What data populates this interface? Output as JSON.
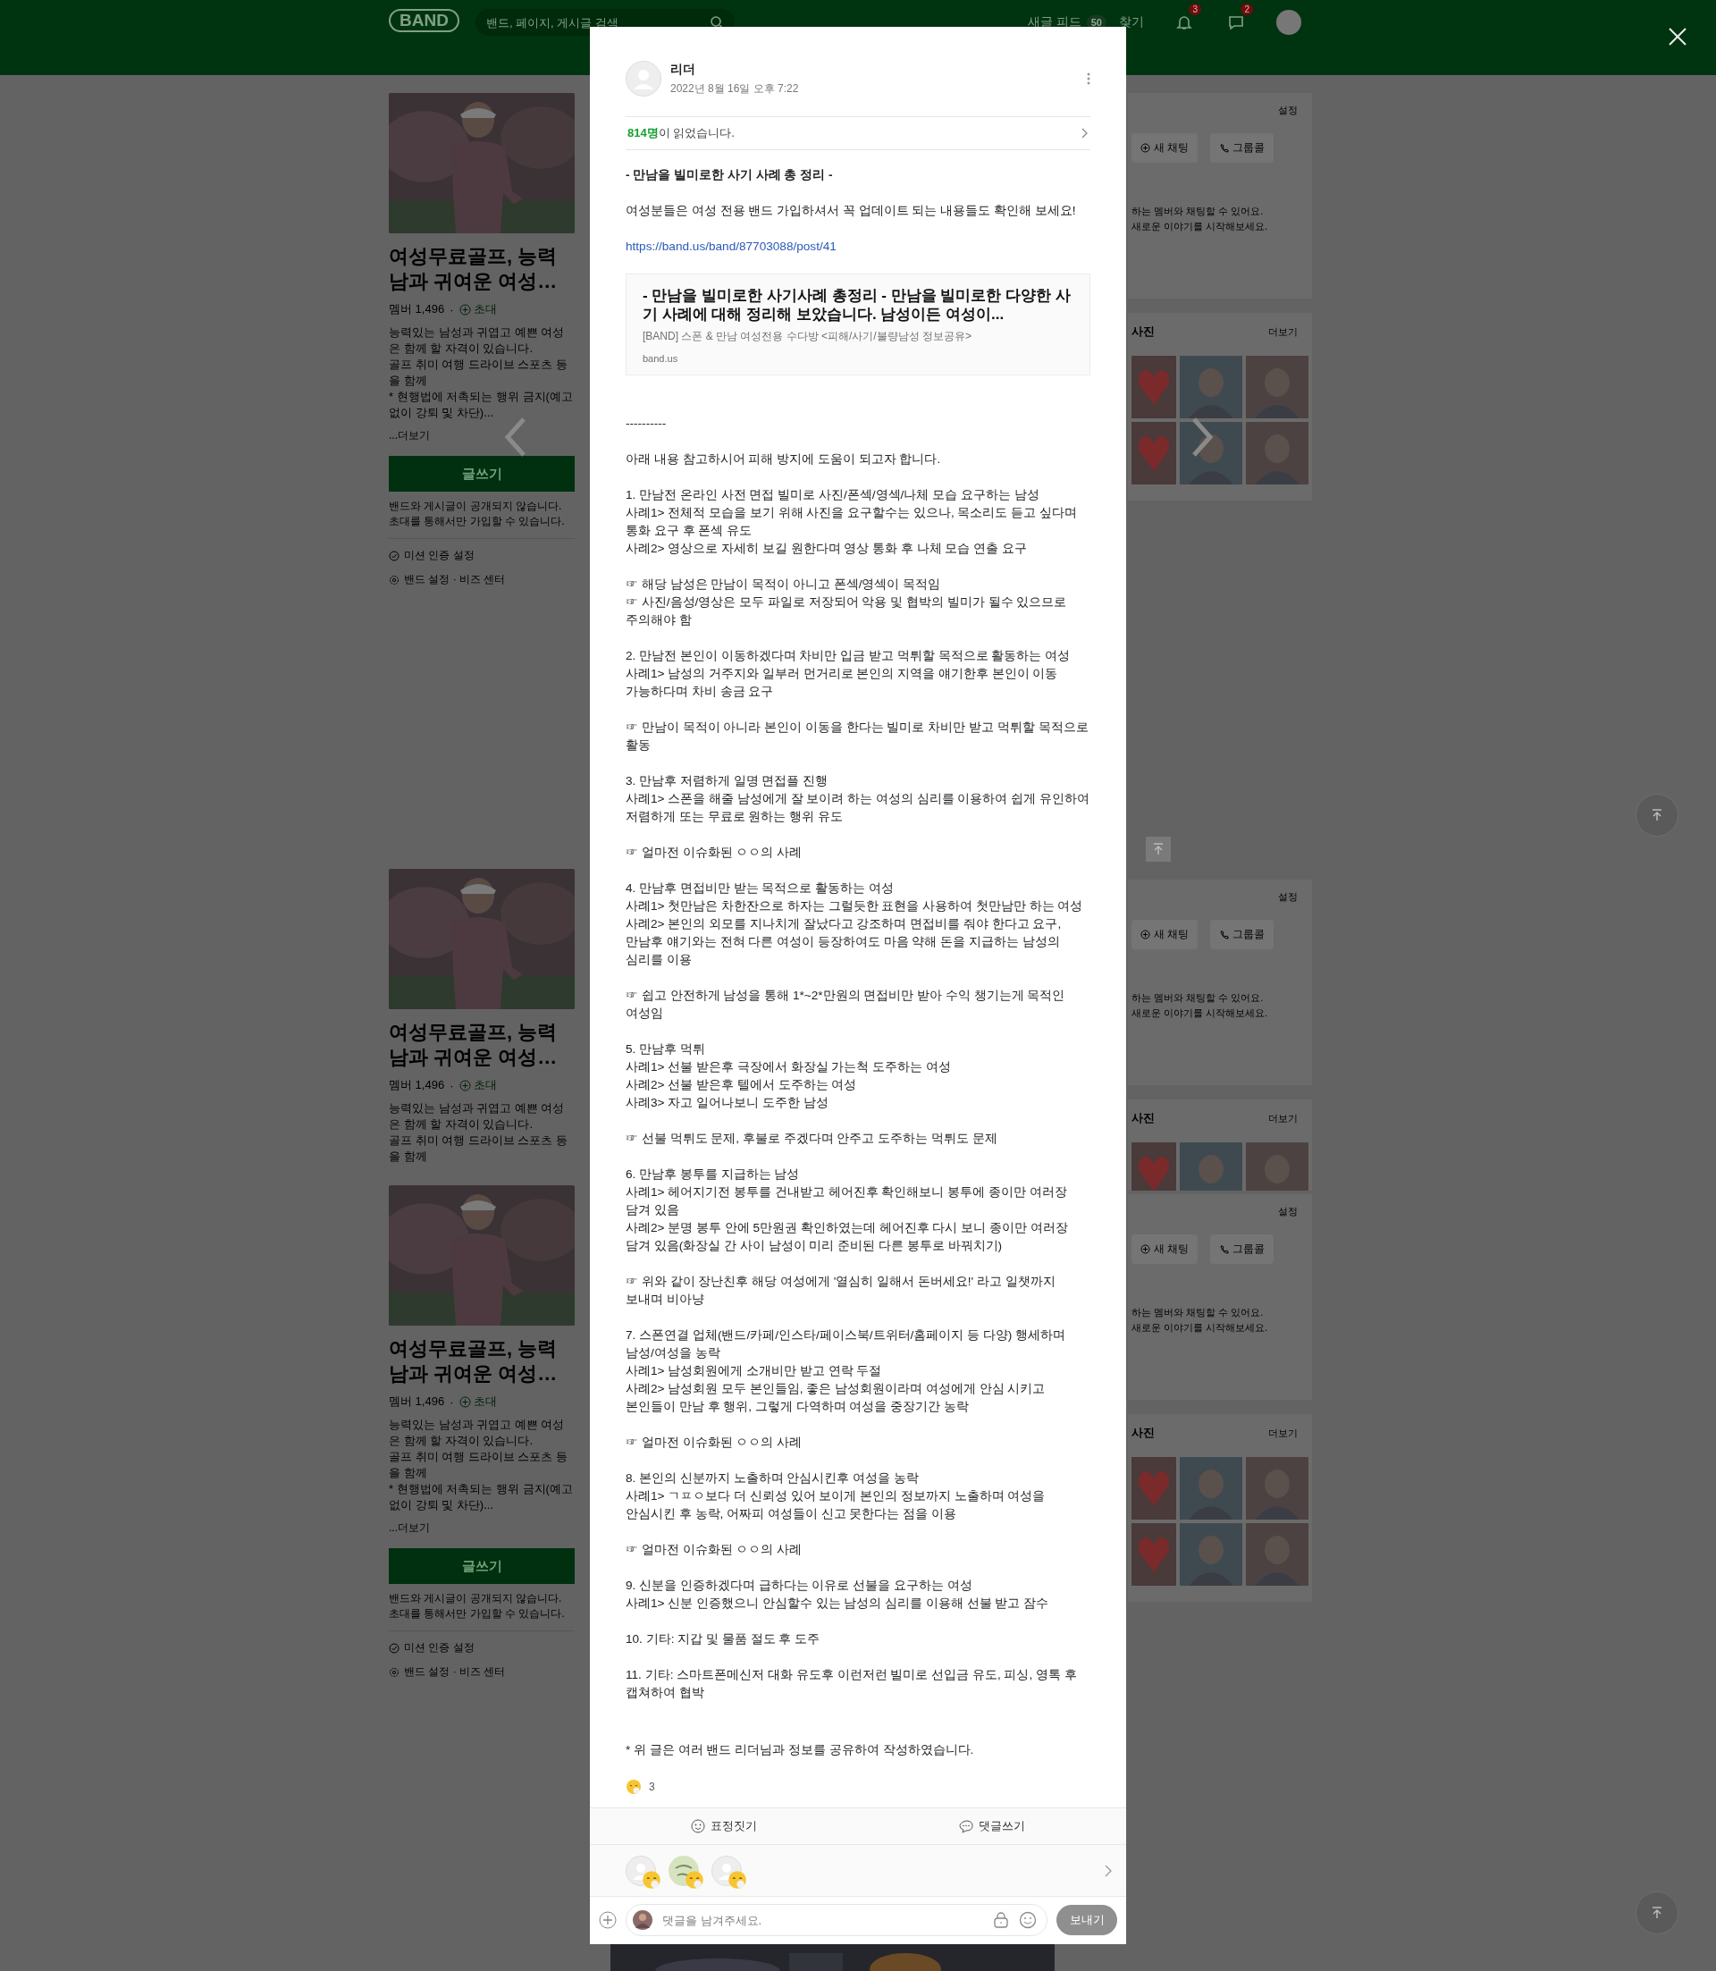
{
  "header": {
    "logo": "BAND",
    "search": {
      "placeholder": "밴드, 페이지, 게시글 검색"
    },
    "feed": {
      "label": "새글 피드",
      "count": "50"
    },
    "find": "찾기",
    "notifications": [
      {
        "kind": "bell",
        "badge": "3"
      },
      {
        "kind": "chat",
        "badge": "2"
      }
    ]
  },
  "left_cards": [
    {
      "kind": "full",
      "title": "여성무료골프, 능력남과 귀여운 여성…",
      "members": "멤버 1,496",
      "separator": "·",
      "invite": "초대",
      "description": "능력있는 남성과 귀엽고 예쁜 여성은 함께 할 자격이 있습니다.\n골프 취미 여행 드라이브 스포츠 등을 함께\n* 현행법에 저촉되는 행위 금지(예고없이 강퇴 및 차단)...",
      "more": "...더보기",
      "write_button": "글쓰기",
      "notice": "밴드와 게시글이 공개되지 않습니다.\n초대를 통해서만 가입할 수 있습니다.",
      "links": [
        {
          "kind": "mission",
          "label": "미션 인증 설정"
        },
        {
          "kind": "settings",
          "label": "밴드 설정 · 비즈 센터"
        }
      ]
    },
    {
      "kind": "cut",
      "title": "여성무료골프, 능력남과 귀여운 여성…",
      "members": "멤버 1,496",
      "separator": "·",
      "invite": "초대",
      "description": "능력있는 남성과 귀엽고 예쁜 여성은 함께 할 자격이 있습니다.\n골프 취미 여행 드라이브 스포츠 등을 함께"
    },
    {
      "kind": "full",
      "title": "여성무료골프, 능력남과 귀여운 여성…",
      "members": "멤버 1,496",
      "separator": "·",
      "invite": "초대",
      "description": "능력있는 남성과 귀엽고 예쁜 여성은 함께 할 자격이 있습니다.\n골프 취미 여행 드라이브 스포츠 등을 함께\n* 현행법에 저촉되는 행위 금지(예고없이 강퇴 및 차단)...",
      "more": "...더보기",
      "write_button": "글쓰기",
      "notice": "밴드와 게시글이 공개되지 않습니다.\n초대를 통해서만 가입할 수 있습니다.",
      "links": [
        {
          "kind": "mission",
          "label": "미션 인증 설정"
        },
        {
          "kind": "settings",
          "label": "밴드 설정 · 비즈 센터"
        }
      ]
    }
  ],
  "right_panels": [
    {
      "kind": "chat",
      "settings": "설정",
      "buttons": [
        {
          "kind": "chat",
          "label": "새 채팅"
        },
        {
          "kind": "call",
          "label": "그룹콜"
        }
      ],
      "text": "하는 멤버와 채팅할 수 있어요.\n새로운 이야기를 시작해보세요."
    },
    {
      "kind": "photos",
      "title": "사진",
      "more": "더보기"
    },
    {
      "kind": "top"
    },
    {
      "kind": "chat",
      "settings": "설정",
      "buttons": [
        {
          "kind": "chat",
          "label": "새 채팅"
        },
        {
          "kind": "call",
          "label": "그룹콜"
        }
      ],
      "text": "하는 멤버와 채팅할 수 있어요.\n새로운 이야기를 시작해보세요."
    },
    {
      "kind": "photos_short",
      "title": "사진",
      "more": "더보기"
    },
    {
      "kind": "chat",
      "settings": "설정",
      "buttons": [
        {
          "kind": "chat",
          "label": "새 채팅"
        },
        {
          "kind": "call",
          "label": "그룹콜"
        }
      ],
      "text": "하는 멤버와 채팅할 수 있어요.\n새로운 이야기를 시작해보세요."
    },
    {
      "kind": "photos",
      "title": "사진",
      "more": "더보기"
    }
  ],
  "post": {
    "author": "리더",
    "date": "2022년 8월 16일 오후 7:22",
    "readers": "**814명**이 읽었습니다.",
    "body": [
      {
        "kind": "heading",
        "lines": [
          "- 만남을 빌미로한 사기 사례 총 정리 -"
        ]
      },
      {
        "kind": "text",
        "lines": [
          "여성분들은 여성 전용 밴드 가입하셔서 꼭 업데이트 되는 내용들도 확인해 보세요!"
        ]
      },
      {
        "kind": "link",
        "lines": [
          "https://band.us/band/87703088/post/41"
        ]
      },
      {
        "kind": "preview",
        "title": "- 만남을 빌미로한 사기사례 총정리 - 만남을 빌미로한 다양한 사기 사례에 대해 정리해 보았습니다. 남성이든 여성이...",
        "source": "[BAND] 스폰 & 만남 여성전용 수다방 <피해/사기/불량남성 정보공유>",
        "domain": "band.us"
      },
      {
        "kind": "spacer"
      },
      {
        "kind": "text",
        "lines": [
          "----------"
        ]
      },
      {
        "kind": "text",
        "lines": [
          "아래 내용 참고하시어 피해 방지에 도움이 되고자 합니다."
        ]
      },
      {
        "kind": "text",
        "lines": [
          "1. 만남전 온라인 사전 면접 빌미로 사진/폰섹/영섹/나체 모습 요구하는 남성",
          "사례1> 전체적 모습을 보기 위해 사진을 요구할수는 있으나, 목소리도 듣고 싶다며 통화 요구 후 폰섹 유도",
          "사례2> 영상으로 자세히 보길 원한다며 영상 통화 후 나체 모습 연출 요구"
        ]
      },
      {
        "kind": "text",
        "lines": [
          "☞ 해당 남성은 만남이 목적이 아니고 폰섹/영섹이 목적임",
          "☞ 사진/음성/영상은 모두 파일로 저장되어 악용 및 협박의 빌미가 될수 있으므로 주의해야 함"
        ]
      },
      {
        "kind": "text",
        "lines": [
          "2. 만남전 본인이 이동하겠다며 차비만 입금 받고 먹튀할 목적으로 활동하는 여성",
          "사례1> 남성의 거주지와 일부러 먼거리로 본인의 지역을 얘기한후 본인이 이동 가능하다며 차비 송금 요구"
        ]
      },
      {
        "kind": "text",
        "lines": [
          "☞ 만남이 목적이 아니라 본인이 이동을 한다는 빌미로 차비만 받고 먹튀할 목적으로 활동"
        ]
      },
      {
        "kind": "text",
        "lines": [
          "3. 만남후 저렴하게 일명 면접플 진행",
          "사례1> 스폰을 해줄 남성에게 잘 보이려 하는 여성의 심리를 이용하여 쉽게 유인하여 저렴하게 또는 무료로 원하는 행위 유도"
        ]
      },
      {
        "kind": "text",
        "lines": [
          "☞ 얼마전 이슈화된 ㅇㅇ의 사례"
        ]
      },
      {
        "kind": "text",
        "lines": [
          "4. 만남후 면접비만 받는 목적으로 활동하는 여성",
          "사례1> 첫만남은 차한잔으로 하자는 그럴듯한 표현을 사용하여 첫만남만 하는 여성",
          "사례2> 본인의 외모를 지나치게 잘났다고 강조하며 면접비를 줘야 한다고 요구, 만남후 얘기와는 전혀 다른 여성이 등장하여도 마음 약해 돈을 지급하는 남성의 심리를 이용"
        ]
      },
      {
        "kind": "text",
        "lines": [
          "☞ 쉽고 안전하게 남성을 통해 1*~2*만원의 면접비만 받아 수익 챙기는게 목적인 여성임"
        ]
      },
      {
        "kind": "text",
        "lines": [
          "5. 만남후 먹튀",
          "사례1> 선불 받은후 극장에서 화장실 가는척 도주하는 여성",
          "사례2> 선불 받은후 텔에서 도주하는 여성",
          "사례3> 자고 일어나보니 도주한 남성"
        ]
      },
      {
        "kind": "text",
        "lines": [
          "☞ 선불 먹튀도 문제, 후불로 주겠다며 안주고 도주하는 먹튀도 문제"
        ]
      },
      {
        "kind": "text",
        "lines": [
          "6. 만남후 봉투를 지급하는 남성",
          "사례1> 헤어지기전 봉투를 건내받고 헤어진후 확인해보니 봉투에 종이만 여러장 담겨 있음",
          "사례2> 분명 봉투 안에 5만원권 확인하였는데 헤어진후 다시 보니 종이만 여러장 담겨 있음(화장실 간 사이 남성이 미리 준비된 다른 봉투로 바꿔치기)"
        ]
      },
      {
        "kind": "text",
        "lines": [
          "☞ 위와 같이 장난친후 해당 여성에게 '열심히 일해서 돈버세요!' 라고 일챗까지 보내며 비아냥"
        ]
      },
      {
        "kind": "text",
        "lines": [
          "7. 스폰연결 업체(밴드/카페/인스타/페이스북/트위터/홈페이지 등 다양) 행세하며 남성/여성을 농락",
          "사례1> 남성회원에게 소개비만 받고 연락 두절",
          "사례2> 남성회원 모두 본인들임, 좋은 남성회원이라며 여성에게 안심 시키고 본인들이 만남 후 행위, 그렇게 다역하며 여성을 중장기간 농락"
        ]
      },
      {
        "kind": "text",
        "lines": [
          "☞ 얼마전 이슈화된 ㅇㅇ의 사례"
        ]
      },
      {
        "kind": "text",
        "lines": [
          "8. 본인의 신분까지 노출하며 안심시킨후 여성을 농락",
          "사례1> ㄱㅍㅇ보다 더 신뢰성 있어 보이게 본인의 정보까지 노출하며 여성을 안심시킨 후 농락, 어짜피 여성들이 신고 못한다는 점을 이용"
        ]
      },
      {
        "kind": "text",
        "lines": [
          "☞ 얼마전 이슈화된 ㅇㅇ의 사례"
        ]
      },
      {
        "kind": "text",
        "lines": [
          "9. 신분을 인증하겠다며 급하다는 이유로 선불을 요구하는 여성",
          "사례1> 신분 인증했으니 안심할수 있는 남성의 심리를 이용해 선불 받고 잠수"
        ]
      },
      {
        "kind": "text",
        "lines": [
          "10. 기타: 지갑 및 물품 절도 후 도주"
        ]
      },
      {
        "kind": "text",
        "lines": [
          "11. 기타: 스마트폰메신저 대화 유도후 이런저런 빌미로 선입금 유도, 피싱, 영톡 후 캡쳐하여 협박"
        ]
      },
      {
        "kind": "spacer"
      },
      {
        "kind": "text",
        "lines": [
          "* 위 글은 여러 밴드 리더님과 정보를 공유하여 작성하였습니다."
        ]
      }
    ],
    "reaction_count": "3",
    "actions": [
      {
        "kind": "emotion",
        "label": "표정짓기"
      },
      {
        "kind": "comment",
        "label": "댓글쓰기"
      }
    ],
    "reactors": [
      {
        "kind": "default"
      },
      {
        "kind": "picture"
      },
      {
        "kind": "default"
      }
    ],
    "comment": {
      "placeholder": "댓글을 남겨주세요.",
      "send": "보내기",
      "send_disabled": true
    }
  }
}
